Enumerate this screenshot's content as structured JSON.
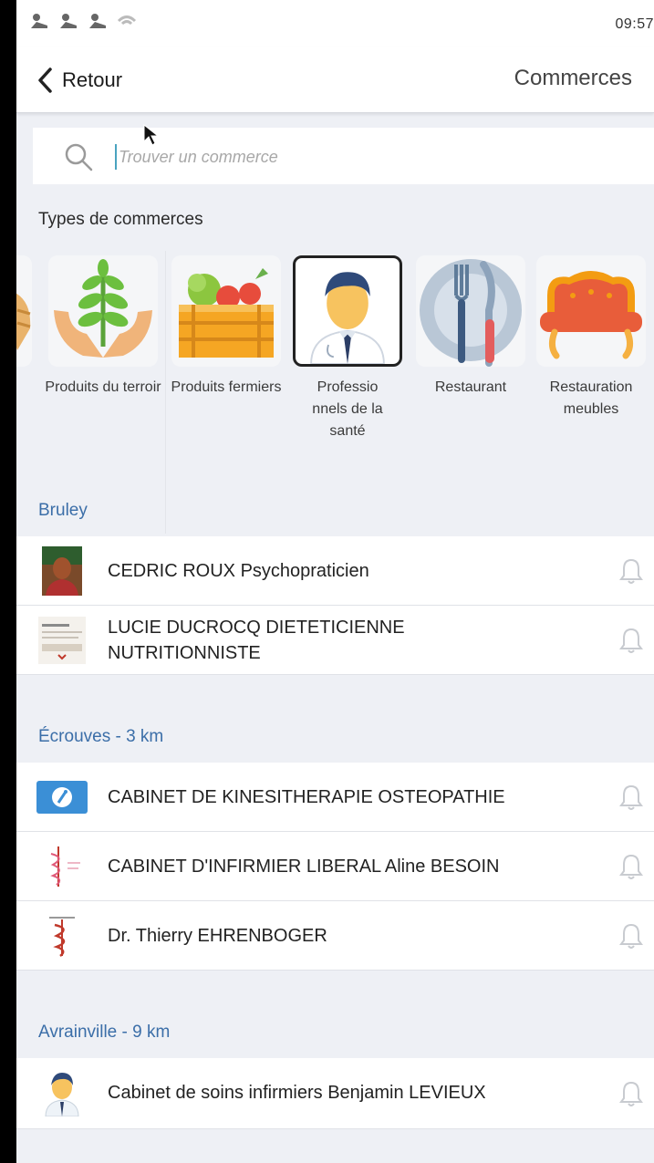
{
  "status_bar": {
    "time": "09:57",
    "notification_icons": [
      "app-notification-icon",
      "app-notification-icon",
      "app-notification-icon",
      "signal-icon"
    ]
  },
  "nav": {
    "back_label": "Retour",
    "title": "Commerces"
  },
  "search": {
    "placeholder": "Trouver un commerce",
    "value": ""
  },
  "types": {
    "label": "Types de commerces",
    "items": [
      {
        "label": "",
        "icon": "partial-hand-icon",
        "selected": false
      },
      {
        "label": "Produits du terroir",
        "icon": "plant-in-hands-icon",
        "selected": false
      },
      {
        "label": "Produits fermiers",
        "icon": "vegetable-crate-icon",
        "selected": false
      },
      {
        "label": "Professio nnels de la santé",
        "icon": "doctor-icon",
        "selected": true
      },
      {
        "label": "Restaurant",
        "icon": "plate-fork-knife-icon",
        "selected": false
      },
      {
        "label": "Restauration meubles",
        "icon": "sofa-icon",
        "selected": false
      }
    ]
  },
  "sections": [
    {
      "title": "Bruley",
      "items": [
        {
          "name": "CEDRIC ROUX Psychopraticien",
          "icon": "portrait-photo-icon"
        },
        {
          "name": "LUCIE DUCROCQ DIETETICIENNE NUTRITIONNISTE",
          "icon": "document-thumbnail-icon"
        }
      ]
    },
    {
      "title": "Écrouves - 3 km",
      "items": [
        {
          "name": "CABINET DE KINESITHERAPIE OSTEOPATHIE",
          "icon": "kine-logo-icon"
        },
        {
          "name": "CABINET D'INFIRMIER LIBERAL Aline BESOIN",
          "icon": "caduceus-icon"
        },
        {
          "name": "Dr. Thierry EHRENBOGER",
          "icon": "caduceus-icon"
        }
      ]
    },
    {
      "title": "Avrainville - 9 km",
      "items": [
        {
          "name": "Cabinet de soins infirmiers Benjamin LEVIEUX",
          "icon": "nurse-avatar-icon"
        }
      ]
    }
  ],
  "colors": {
    "section_title": "#3b6ea8",
    "background": "#eef0f5"
  }
}
